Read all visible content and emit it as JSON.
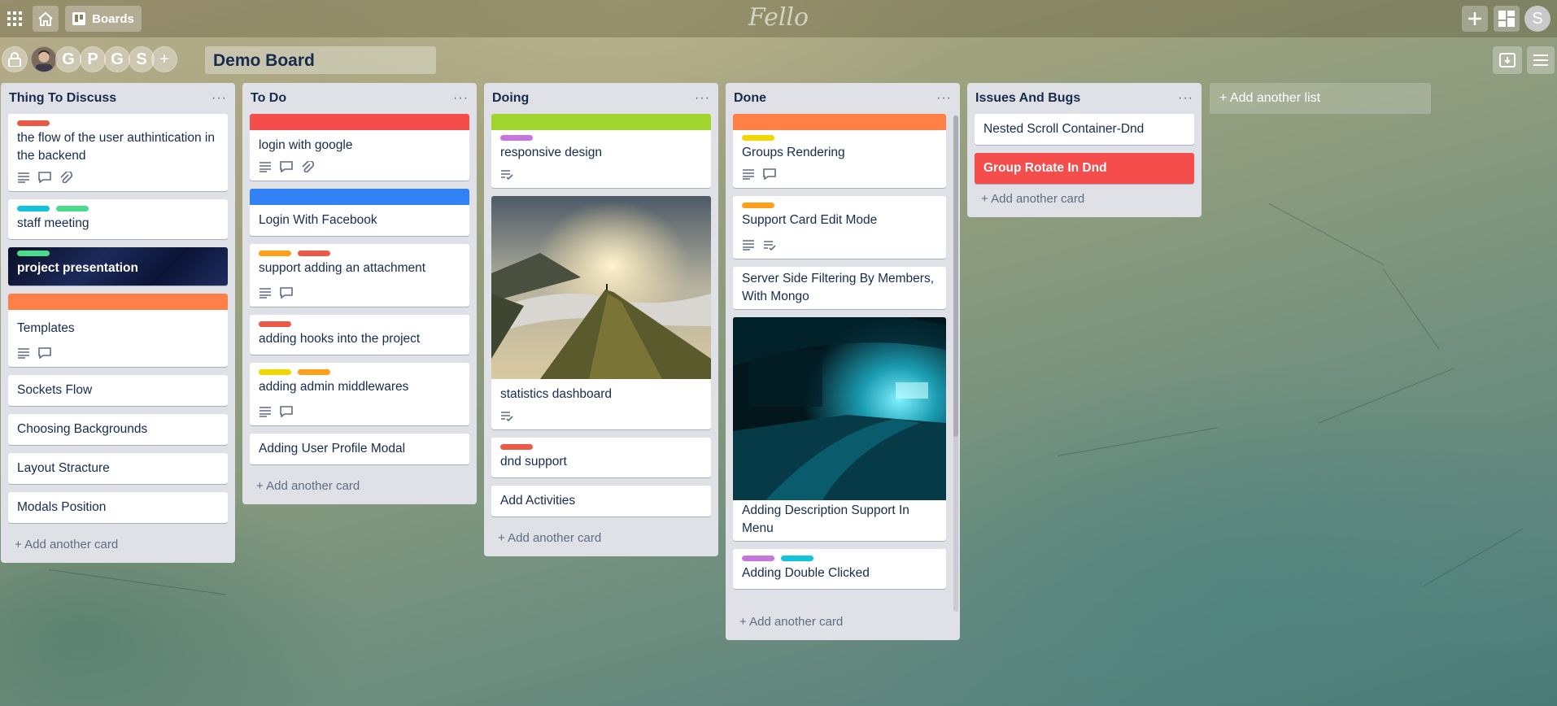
{
  "app": {
    "brand": "Fello",
    "boards_label": "Boards",
    "user_initial": "S"
  },
  "board": {
    "title": "Demo Board",
    "members": [
      "G",
      "P",
      "G",
      "S"
    ],
    "add_member": "+"
  },
  "colors": {
    "red": "#f54c4c",
    "orange": "#ff8047",
    "green": "#a0d42e",
    "blue": "#3183f5",
    "purple": "#c675dd",
    "cyan": "#13c2dd",
    "teal": "#4adc8c",
    "yellow": "#f2d600",
    "amber": "#ffa01c"
  },
  "add_card_label": "+ Add another card",
  "add_list_label": "+ Add another list",
  "lists": [
    {
      "title": "Thing To Discuss",
      "cards": [
        {
          "text": "the flow of the user authintication in the backend",
          "labels": [
            "red"
          ],
          "badges": [
            "description",
            "comment",
            "attachment"
          ]
        },
        {
          "text": "staff meeting",
          "labels": [
            "cyan",
            "teal"
          ]
        },
        {
          "text": "project presentation",
          "labels": [
            "teal"
          ],
          "style": "dark-image"
        },
        {
          "text": "Templates",
          "cover": "orange",
          "badges": [
            "description",
            "comment"
          ]
        },
        {
          "text": "Sockets Flow"
        },
        {
          "text": "Choosing Backgrounds"
        },
        {
          "text": "Layout Stracture"
        },
        {
          "text": "Modals Position"
        }
      ]
    },
    {
      "title": "To Do",
      "cards": [
        {
          "text": "login with google",
          "cover": "red",
          "badges": [
            "description",
            "comment",
            "attachment"
          ]
        },
        {
          "text": "Login With Facebook",
          "cover": "blue"
        },
        {
          "text": "support adding an attachment",
          "labels": [
            "amber",
            "red"
          ],
          "badges": [
            "description",
            "comment"
          ]
        },
        {
          "text": "adding hooks into the project",
          "labels": [
            "red"
          ]
        },
        {
          "text": "adding admin middlewares",
          "labels": [
            "yellow",
            "amber"
          ],
          "badges": [
            "description",
            "comment"
          ]
        },
        {
          "text": "Adding User Profile Modal"
        }
      ]
    },
    {
      "title": "Doing",
      "cards": [
        {
          "text": "responsive design",
          "cover": "green",
          "labels": [
            "purple"
          ],
          "badges": [
            "checklist"
          ]
        },
        {
          "text": "statistics dashboard",
          "image": "mountain",
          "badges": [
            "checklist"
          ]
        },
        {
          "text": "dnd support",
          "labels": [
            "red"
          ]
        },
        {
          "text": "Add Activities"
        }
      ]
    },
    {
      "title": "Done",
      "cards": [
        {
          "text": "Groups Rendering",
          "cover": "orange",
          "labels": [
            "yellow"
          ],
          "badges": [
            "description",
            "comment"
          ]
        },
        {
          "text": "Support Card Edit Mode",
          "labels": [
            "amber"
          ],
          "badges": [
            "description",
            "checklist"
          ]
        },
        {
          "text": "Server Side Filtering By Members, With Mongo"
        },
        {
          "text": "Adding Description Support In Menu",
          "image": "tunnel"
        },
        {
          "text": "Adding Double Clicked",
          "labels": [
            "purple",
            "cyan"
          ]
        }
      ]
    },
    {
      "title": "Issues And Bugs",
      "cards": [
        {
          "text": "Nested Scroll Container-Dnd"
        },
        {
          "text": "Group Rotate In Dnd",
          "style": "red"
        }
      ]
    }
  ]
}
